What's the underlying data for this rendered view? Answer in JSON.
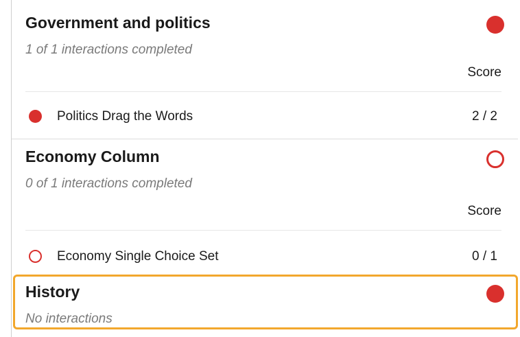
{
  "accent_colors": {
    "filled": "#d9302d",
    "outline": "#d9302d",
    "highlight": "#f2a72c"
  },
  "sections": [
    {
      "title": "Government and politics",
      "status_icon": "filled-circle-icon",
      "subtitle": "1 of 1 interactions completed",
      "score_header": "Score",
      "items": [
        {
          "label": "Politics Drag the Words",
          "score": "2 / 2",
          "status_icon": "filled-circle-icon"
        }
      ]
    },
    {
      "title": "Economy Column",
      "status_icon": "empty-circle-icon",
      "subtitle": "0 of 1 interactions completed",
      "score_header": "Score",
      "items": [
        {
          "label": "Economy Single Choice Set",
          "score": "0 / 1",
          "status_icon": "empty-circle-icon"
        }
      ]
    },
    {
      "title": "History",
      "status_icon": "filled-circle-icon",
      "subtitle": "No interactions"
    }
  ]
}
